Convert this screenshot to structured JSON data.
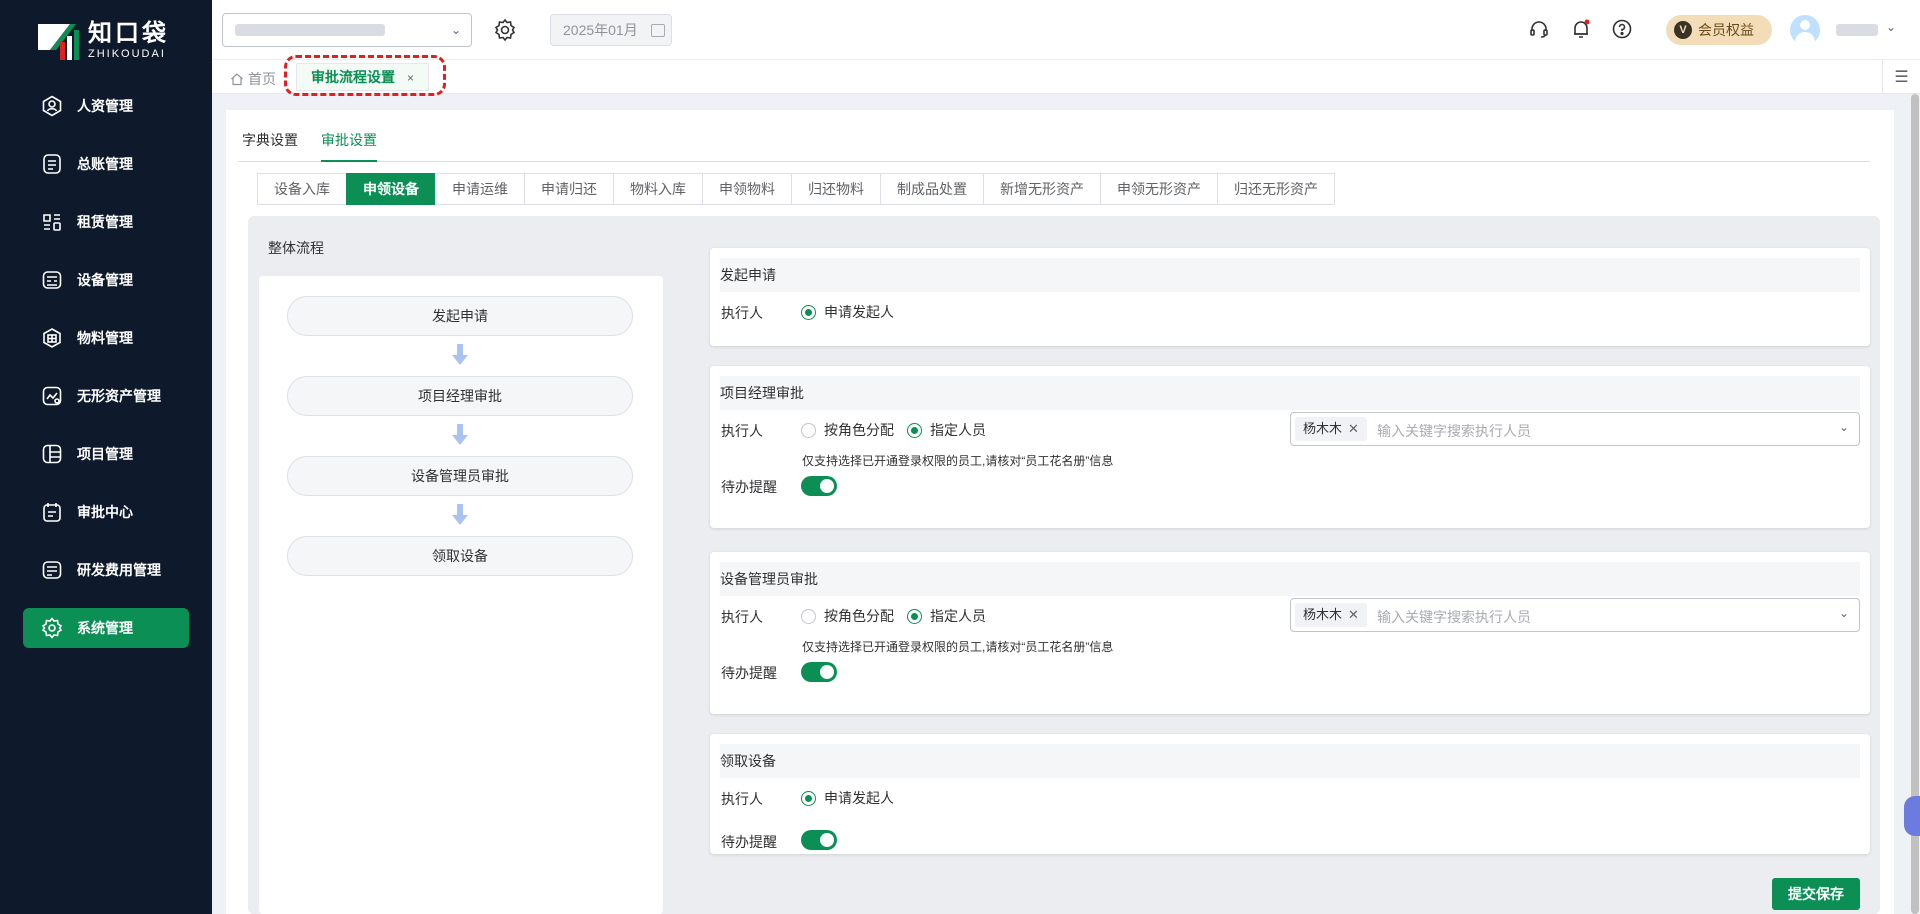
{
  "brand": {
    "name_cn": "知口袋",
    "name_en": "ZHIKOUDAI",
    "color": "#0c8f55"
  },
  "sidebar": {
    "items": [
      {
        "label": "人资管理",
        "icon": "person-icon",
        "active": false
      },
      {
        "label": "总账管理",
        "icon": "ledger-icon",
        "active": false
      },
      {
        "label": "租赁管理",
        "icon": "lease-icon",
        "active": false
      },
      {
        "label": "设备管理",
        "icon": "equipment-icon",
        "active": false
      },
      {
        "label": "物料管理",
        "icon": "material-icon",
        "active": false
      },
      {
        "label": "无形资产管理",
        "icon": "intangible-asset-icon",
        "active": false
      },
      {
        "label": "项目管理",
        "icon": "project-icon",
        "active": false
      },
      {
        "label": "审批中心",
        "icon": "approval-icon",
        "active": false
      },
      {
        "label": "研发费用管理",
        "icon": "rd-cost-icon",
        "active": false
      },
      {
        "label": "系统管理",
        "icon": "gear-icon",
        "active": true
      }
    ]
  },
  "header": {
    "date": "2025年01月",
    "vip_badge": "V",
    "vip_label": "会员权益",
    "icons": [
      "headset-icon",
      "bell-icon",
      "help-icon"
    ]
  },
  "tabsbar": {
    "home_label": "首页",
    "current_tab": "审批流程设置",
    "close_symbol": "×"
  },
  "main": {
    "top_tabs": [
      {
        "label": "字典设置",
        "active": false
      },
      {
        "label": "审批设置",
        "active": true
      }
    ],
    "sub_tabs": [
      {
        "label": "设备入库",
        "active": false
      },
      {
        "label": "申领设备",
        "active": true
      },
      {
        "label": "申请运维",
        "active": false
      },
      {
        "label": "申请归还",
        "active": false
      },
      {
        "label": "物料入库",
        "active": false
      },
      {
        "label": "申领物料",
        "active": false
      },
      {
        "label": "归还物料",
        "active": false
      },
      {
        "label": "制成品处置",
        "active": false
      },
      {
        "label": "新增无形资产",
        "active": false
      },
      {
        "label": "申领无形资产",
        "active": false
      },
      {
        "label": "归还无形资产",
        "active": false
      }
    ],
    "flow": {
      "title": "整体流程",
      "nodes": [
        "发起申请",
        "项目经理审批",
        "设备管理员审批",
        "领取设备"
      ]
    },
    "cards": [
      {
        "title": "发起申请",
        "executor_label": "执行人",
        "option": "申请发起人"
      },
      {
        "title": "项目经理审批",
        "executor_label": "执行人",
        "option_role": "按角色分配",
        "option_person": "指定人员",
        "selected": "指定人员",
        "chip": "杨木木",
        "placeholder": "输入关键字搜索执行人员",
        "hint": "仅支持选择已开通登录权限的员工,请核对“员工花名册”信息",
        "reminder_label": "待办提醒",
        "reminder_on": true
      },
      {
        "title": "设备管理员审批",
        "executor_label": "执行人",
        "option_role": "按角色分配",
        "option_person": "指定人员",
        "selected": "指定人员",
        "chip": "杨木木",
        "placeholder": "输入关键字搜索执行人员",
        "hint": "仅支持选择已开通登录权限的员工,请核对“员工花名册”信息",
        "reminder_label": "待办提醒",
        "reminder_on": true
      },
      {
        "title": "领取设备",
        "executor_label": "执行人",
        "option": "申请发起人",
        "reminder_label": "待办提醒",
        "reminder_on": true
      }
    ],
    "submit_label": "提交保存"
  }
}
